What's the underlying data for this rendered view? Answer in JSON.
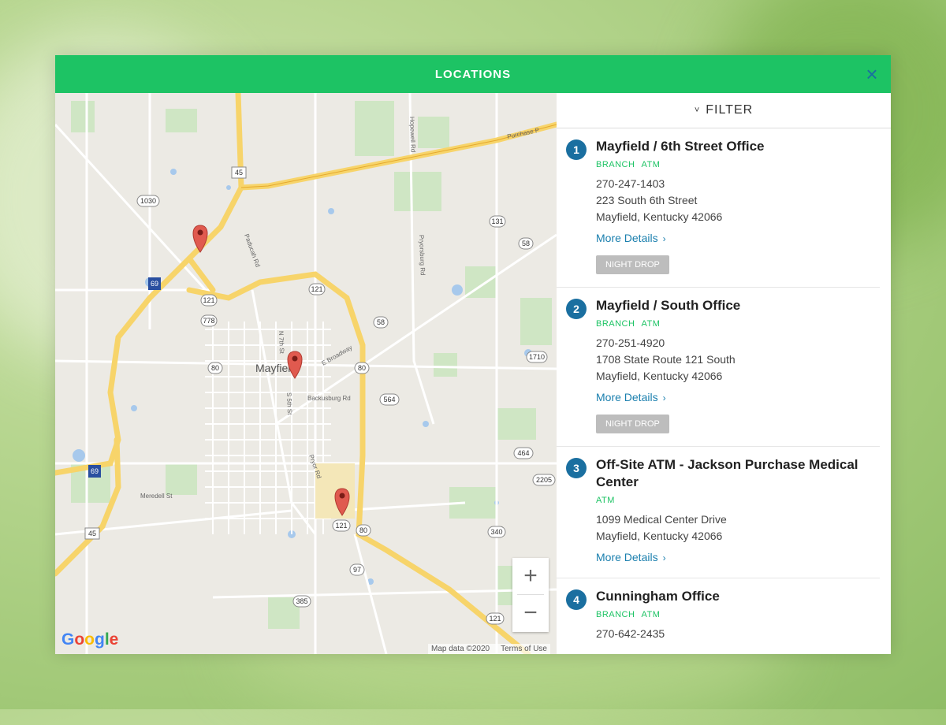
{
  "header": {
    "title": "LOCATIONS",
    "close_symbol": "×"
  },
  "panel": {
    "filter_label": "FILTER",
    "filter_chevron": "˅",
    "locations": [
      {
        "number": "1",
        "name": "Mayfield / 6th Street Office",
        "tags": [
          "BRANCH",
          "ATM"
        ],
        "phone": "270-247-1403",
        "address1": "223 South 6th Street",
        "address2": "Mayfield, Kentucky 42066",
        "more": "More Details",
        "more_chevron": "›",
        "night_drop": "NIGHT DROP"
      },
      {
        "number": "2",
        "name": "Mayfield / South Office",
        "tags": [
          "BRANCH",
          "ATM"
        ],
        "phone": "270-251-4920",
        "address1": "1708 State Route 121 South",
        "address2": "Mayfield, Kentucky 42066",
        "more": "More Details",
        "more_chevron": "›",
        "night_drop": "NIGHT DROP"
      },
      {
        "number": "3",
        "name": "Off-Site ATM - Jackson Purchase Medical Center",
        "tags": [
          "ATM"
        ],
        "address1": "1099 Medical Center Drive",
        "address2": "Mayfield, Kentucky 42066",
        "more": "More Details",
        "more_chevron": "›"
      },
      {
        "number": "4",
        "name": "Cunningham Office",
        "tags": [
          "BRANCH",
          "ATM"
        ],
        "phone": "270-642-2435"
      }
    ]
  },
  "map": {
    "city_label": "Mayfield",
    "road_labels": {
      "purchase": "Purchase P",
      "r45_top": "45",
      "r1030": "1030",
      "r131": "131",
      "r58_right": "58",
      "r121_a": "121",
      "r121_b": "121",
      "r778": "778",
      "r69": "69",
      "r58": "58",
      "r80": "80",
      "r80_b": "80",
      "r1710": "1710",
      "r564": "564",
      "r464": "464",
      "r2205": "2205",
      "r69_b": "69",
      "r45_b": "45",
      "r121_c": "121",
      "r80_c": "80",
      "r340": "340",
      "r97": "97",
      "r385": "385",
      "r121_d": "121",
      "broadway": "E Broadway",
      "backusburg": "Backusburg Rd",
      "paducah": "Paducah Rd",
      "hopewell": "Hopewell Rd",
      "pryorsburg": "Pryorsburg Rd",
      "n7th": "N 7th St",
      "s5th": "S 5th St",
      "pryor": "Pryor Rd",
      "mcredith": "Meredell St"
    },
    "google": [
      "G",
      "o",
      "o",
      "g",
      "l",
      "e"
    ],
    "footer_data": "Map data ©2020",
    "footer_terms": "Terms of Use",
    "zoom_in": "+",
    "zoom_out": "−",
    "google_colors": [
      "#4285F4",
      "#EA4335",
      "#FBBC05",
      "#4285F4",
      "#34A853",
      "#EA4335"
    ]
  }
}
